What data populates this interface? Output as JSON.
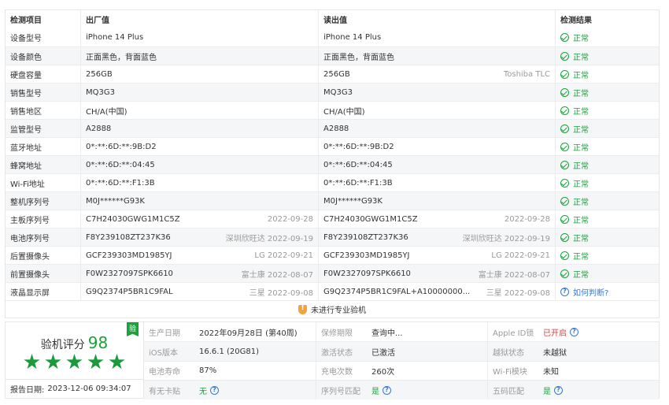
{
  "table": {
    "headers": {
      "item": "检测项目",
      "factory": "出厂值",
      "read": "读出值",
      "result": "检测结果"
    },
    "rows": [
      {
        "item": "设备型号",
        "factory": "iPhone 14 Plus",
        "factory_note": "",
        "read": "iPhone 14 Plus",
        "read_note": "",
        "result": "正常",
        "result_type": "ok"
      },
      {
        "item": "设备颜色",
        "factory": "正面黑色，背面蓝色",
        "factory_note": "",
        "read": "正面黑色，背面蓝色",
        "read_note": "",
        "result": "正常",
        "result_type": "ok"
      },
      {
        "item": "硬盘容量",
        "factory": "256GB",
        "factory_note": "",
        "read": "256GB",
        "read_note": "Toshiba TLC",
        "result": "正常",
        "result_type": "ok"
      },
      {
        "item": "销售型号",
        "factory": "MQ3G3",
        "factory_note": "",
        "read": "MQ3G3",
        "read_note": "",
        "result": "正常",
        "result_type": "ok"
      },
      {
        "item": "销售地区",
        "factory": "CH/A(中国)",
        "factory_note": "",
        "read": "CH/A(中国)",
        "read_note": "",
        "result": "正常",
        "result_type": "ok"
      },
      {
        "item": "监管型号",
        "factory": "A2888",
        "factory_note": "",
        "read": "A2888",
        "read_note": "",
        "result": "正常",
        "result_type": "ok"
      },
      {
        "item": "蓝牙地址",
        "factory": "0*:**:6D:**:9B:D2",
        "factory_note": "",
        "read": "0*:**:6D:**:9B:D2",
        "read_note": "",
        "result": "正常",
        "result_type": "ok"
      },
      {
        "item": "蜂窝地址",
        "factory": "0*:**:6D:**:04:45",
        "factory_note": "",
        "read": "0*:**:6D:**:04:45",
        "read_note": "",
        "result": "正常",
        "result_type": "ok"
      },
      {
        "item": "Wi-Fi地址",
        "factory": "0*:**:6D:**:F1:3B",
        "factory_note": "",
        "read": "0*:**:6D:**:F1:3B",
        "read_note": "",
        "result": "正常",
        "result_type": "ok"
      },
      {
        "item": "整机序列号",
        "factory": "M0J******G93K",
        "factory_note": "",
        "read": "M0J******G93K",
        "read_note": "",
        "result": "正常",
        "result_type": "ok"
      },
      {
        "item": "主板序列号",
        "factory": "C7H24030GWG1M1C5Z",
        "factory_note": "2022-09-28",
        "read": "C7H24030GWG1M1C5Z",
        "read_note": "2022-09-28",
        "result": "正常",
        "result_type": "ok"
      },
      {
        "item": "电池序列号",
        "factory": "F8Y239108ZT237K36",
        "factory_note": "深圳欣旺达 2022-09-19",
        "read": "F8Y239108ZT237K36",
        "read_note": "深圳欣旺达 2022-09-19",
        "result": "正常",
        "result_type": "ok"
      },
      {
        "item": "后置摄像头",
        "factory": "GCF239303MD1985YJ",
        "factory_note": "LG 2022-09-21",
        "read": "GCF239303MD1985YJ",
        "read_note": "LG 2022-09-21",
        "result": "正常",
        "result_type": "ok"
      },
      {
        "item": "前置摄像头",
        "factory": "F0W2327097SPK6610",
        "factory_note": "富士康 2022-08-07",
        "read": "F0W2327097SPK6610",
        "read_note": "富士康 2022-08-07",
        "result": "正常",
        "result_type": "ok"
      },
      {
        "item": "液晶显示屏",
        "factory": "G9Q2374P5BR1C9FAL",
        "factory_note": "三星 2022-09-08",
        "read": "G9Q2374P5BR1C9FAL+A10000000...",
        "read_note": "三星 2022-09-08",
        "result": "如何判断?",
        "result_type": "question"
      }
    ],
    "footer": "未进行专业验机"
  },
  "summary": {
    "score_label": "验机评分",
    "score": "98",
    "badge": "验",
    "stars": 5,
    "report_date_label": "报告日期:",
    "report_date": "2023-12-06 09:34:07",
    "fields": [
      {
        "label": "生产日期",
        "value": "2022年09月28日 (第40周)",
        "style": "",
        "help": false
      },
      {
        "label": "保修期限",
        "value": "查询中...",
        "style": "",
        "help": false
      },
      {
        "label": "Apple ID锁",
        "value": "已开启",
        "style": "red",
        "help": true
      },
      {
        "label": "iOS版本",
        "value": "16.6.1 (20G81)",
        "style": "",
        "help": false
      },
      {
        "label": "激活状态",
        "value": "已激活",
        "style": "",
        "help": false
      },
      {
        "label": "越狱状态",
        "value": "未越狱",
        "style": "",
        "help": false
      },
      {
        "label": "电池寿命",
        "value": "87%",
        "style": "",
        "help": false
      },
      {
        "label": "充电次数",
        "value": "260次",
        "style": "",
        "help": false
      },
      {
        "label": "Wi-Fi模块",
        "value": "未知",
        "style": "",
        "help": false
      },
      {
        "label": "有无卡贴",
        "value": "无",
        "style": "green",
        "help": true
      },
      {
        "label": "序列号匹配",
        "value": "是",
        "style": "green",
        "help": true
      },
      {
        "label": "五码匹配",
        "value": "是",
        "style": "green",
        "help": true
      }
    ]
  },
  "icons": {
    "ok": "check-circle-icon",
    "question": "question-circle-icon",
    "warning": "shield-warning-icon",
    "star": "star-icon"
  },
  "colors": {
    "ok_green": "#1aa33b",
    "link_blue": "#3a78d6",
    "alert_red": "#e23b3b",
    "warn_orange": "#f2a33a"
  }
}
